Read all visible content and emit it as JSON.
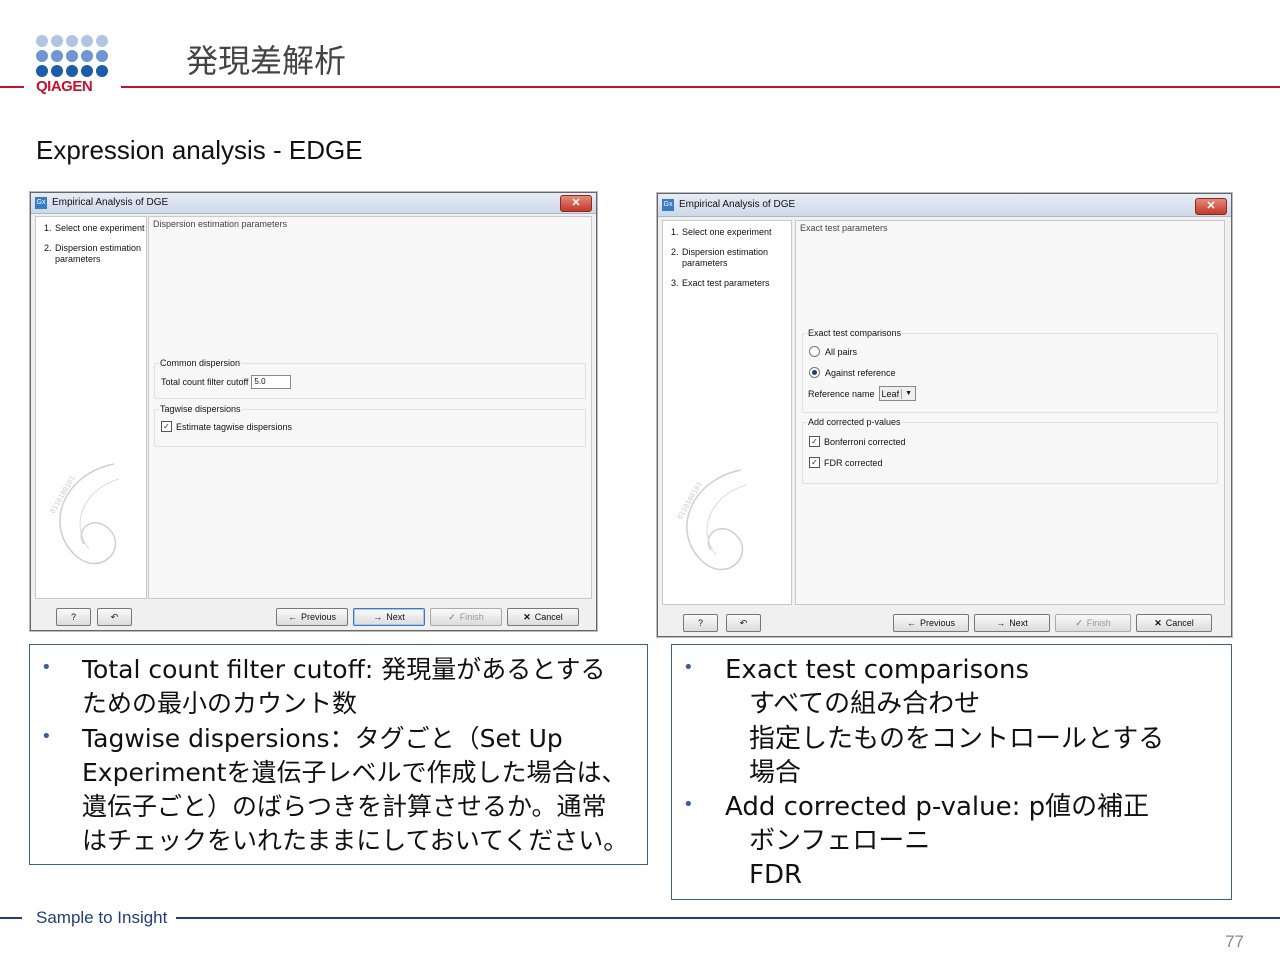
{
  "header": {
    "logo_text": "QIAGEN",
    "title": "発現差解析",
    "subtitle": "Expression analysis - EDGE",
    "brand_color": "#c8102e"
  },
  "dialog_left": {
    "window_title": "Empirical Analysis of DGE",
    "close_label": "✕",
    "steps": [
      {
        "num": "1.",
        "label": "Select one experiment"
      },
      {
        "num": "2.",
        "label": "Dispersion estimation parameters"
      }
    ],
    "section_title": "Dispersion estimation parameters",
    "common_group_label": "Common dispersion",
    "cutoff_label": "Total count filter cutoff",
    "cutoff_value": "5.0",
    "tagwise_group_label": "Tagwise dispersions",
    "tagwise_checkbox_label": "Estimate tagwise dispersions",
    "tagwise_checked": true,
    "buttons": {
      "help": "?",
      "reset": "↶",
      "previous": "Previous",
      "next": "Next",
      "finish": "Finish",
      "cancel": "Cancel"
    }
  },
  "dialog_right": {
    "window_title": "Empirical Analysis of DGE",
    "close_label": "✕",
    "steps": [
      {
        "num": "1.",
        "label": "Select one experiment"
      },
      {
        "num": "2.",
        "label": "Dispersion estimation parameters"
      },
      {
        "num": "3.",
        "label": "Exact test parameters"
      }
    ],
    "section_title": "Exact test parameters",
    "comparisons_group_label": "Exact test comparisons",
    "radio_all_pairs": "All pairs",
    "radio_against_reference": "Against reference",
    "selected_radio": "Against reference",
    "reference_name_label": "Reference name",
    "reference_name_value": "Leaf",
    "pvalues_group_label": "Add corrected p-values",
    "bonferroni_label": "Bonferroni corrected",
    "fdr_label": "FDR corrected",
    "bonferroni_checked": true,
    "fdr_checked": true,
    "buttons": {
      "help": "?",
      "reset": "↶",
      "previous": "Previous",
      "next": "Next",
      "finish": "Finish",
      "cancel": "Cancel"
    }
  },
  "notes_left": {
    "bullet1_line1": "Total count filter cutoff: 発現量があるとする",
    "bullet1_line2": "ための最小のカウント数",
    "bullet2_line1": "Tagwise dispersions：タグごと（Set Up",
    "bullet2_line2": "Experimentを遺伝子レベルで作成した場合は、",
    "bullet2_line3": "遺伝子ごと）のばらつきを計算させるか。通常",
    "bullet2_line4": "はチェックをいれたままにしておいてください。"
  },
  "notes_right": {
    "bullet1": "Exact test comparisons",
    "bullet1_sub1": "すべての組み合わせ",
    "bullet1_sub2": "指定したものをコントロールとする",
    "bullet1_sub3": "場合",
    "bullet2": "Add corrected p-value: p値の補正",
    "bullet2_sub1": "ボンフェローニ",
    "bullet2_sub2": "FDR"
  },
  "footer": {
    "tagline": "Sample to Insight",
    "page_number": "77"
  }
}
